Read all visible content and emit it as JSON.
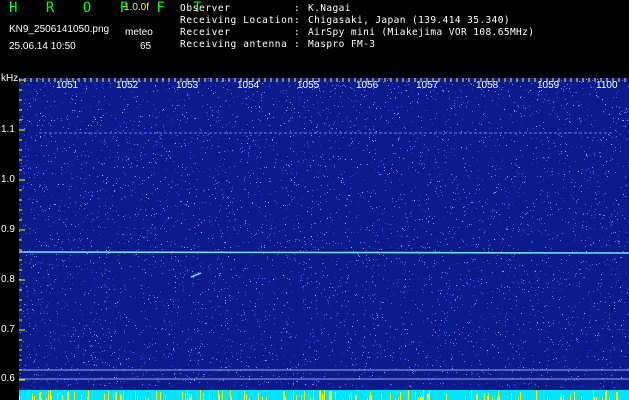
{
  "header": {
    "app_title": "H R O F F T",
    "version": "1.0.0f",
    "file_name": "KN9_2506141050.png",
    "mode": "meteo",
    "timestamp": "25.06.14 10:50",
    "count": "65"
  },
  "meta": [
    {
      "key": "Observer",
      "value": "K.Nagai"
    },
    {
      "key": "Receiving Location",
      "value": "Chigasaki, Japan (139.414 35.340)"
    },
    {
      "key": "Receiver",
      "value": "AirSpy mini (Miakejima VOR 108.65MHz)"
    },
    {
      "key": "Receiving antenna",
      "value": "Maspro FM-3"
    }
  ],
  "axis": {
    "unit": "kHz",
    "y_ticks": [
      "1.1",
      "1.0",
      "0.9",
      "0.8",
      "0.7",
      "0.6"
    ],
    "x_ticks": [
      "1051",
      "1052",
      "1053",
      "1054",
      "1055",
      "1056",
      "1057",
      "1058",
      "1059",
      "1100"
    ]
  },
  "colors": {
    "background": "#000000",
    "title": "#00ff00",
    "version": "#ffff00",
    "spectrogram_base": "#0c1a8c",
    "noise": "#5a7aff",
    "signal_line": "#6fe3ff",
    "ticks": "#ffff00",
    "bottom_band": "#00e5ff"
  }
}
